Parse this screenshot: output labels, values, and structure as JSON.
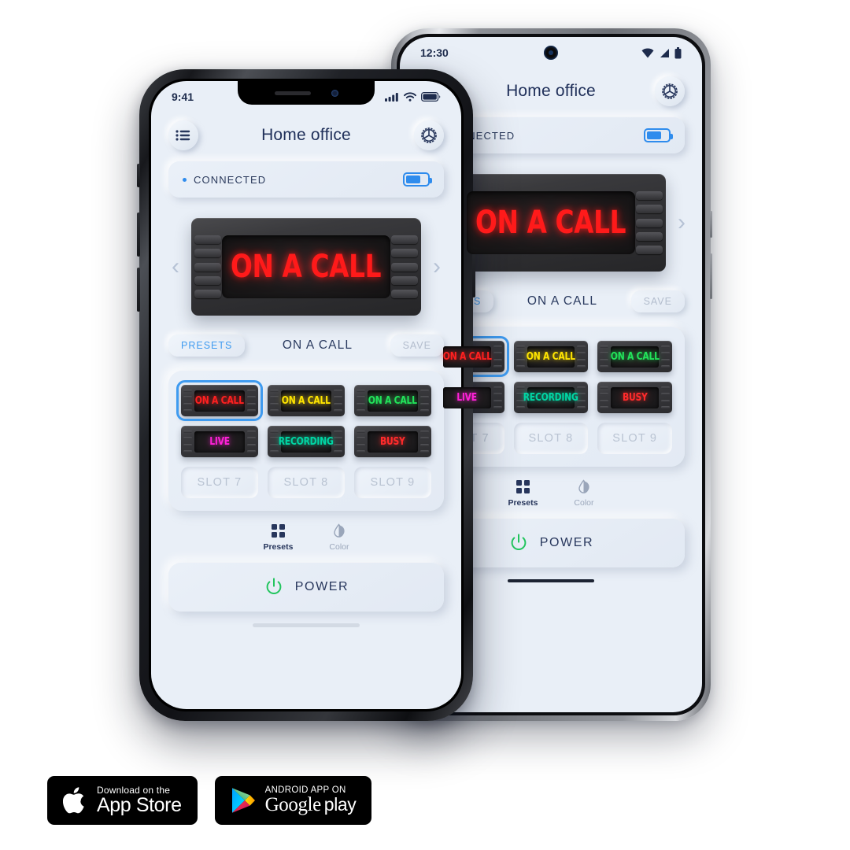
{
  "app": {
    "title": "Home office",
    "connection": {
      "status": "CONNECTED",
      "battery_level": "68"
    },
    "current_preset_label": "ON A CALL",
    "presets_button": "PRESETS",
    "save_button": "SAVE",
    "power_button": "POWER",
    "nav_prev": "‹",
    "nav_next": "›",
    "sign": {
      "text": "ON A CALL",
      "color": "#ff1a1a"
    },
    "tabs": [
      {
        "label": "Presets",
        "icon": "grid-icon",
        "active": true
      },
      {
        "label": "Color",
        "icon": "droplet-icon",
        "active": false
      }
    ],
    "presets": [
      {
        "text": "ON A CALL",
        "color": "#ff2020",
        "selected": true,
        "empty": false
      },
      {
        "text": "ON A CALL",
        "color": "#ffe500",
        "selected": false,
        "empty": false
      },
      {
        "text": "ON A CALL",
        "color": "#22e35a",
        "selected": false,
        "empty": false
      },
      {
        "text": "LIVE",
        "color": "#ff21d8",
        "selected": false,
        "empty": false
      },
      {
        "text": "RECORDING",
        "color": "#00d6a4",
        "selected": false,
        "empty": false
      },
      {
        "text": "BUSY",
        "color": "#ff2b2b",
        "selected": false,
        "empty": false
      },
      {
        "text": "SLOT 7",
        "color": "",
        "selected": false,
        "empty": true
      },
      {
        "text": "SLOT 8",
        "color": "",
        "selected": false,
        "empty": true
      },
      {
        "text": "SLOT 9",
        "color": "",
        "selected": false,
        "empty": true
      }
    ]
  },
  "iphone": {
    "status_time": "9:41"
  },
  "android": {
    "status_time": "12:30"
  },
  "badges": {
    "appstore": {
      "top": "Download on the",
      "bottom": "App Store"
    },
    "googleplay": {
      "top": "ANDROID APP ON",
      "bottom_1": "Google",
      "bottom_2": "play"
    }
  },
  "accent": {
    "blue": "#3f9bf0",
    "green": "#22c55e",
    "navy": "#27365c"
  }
}
